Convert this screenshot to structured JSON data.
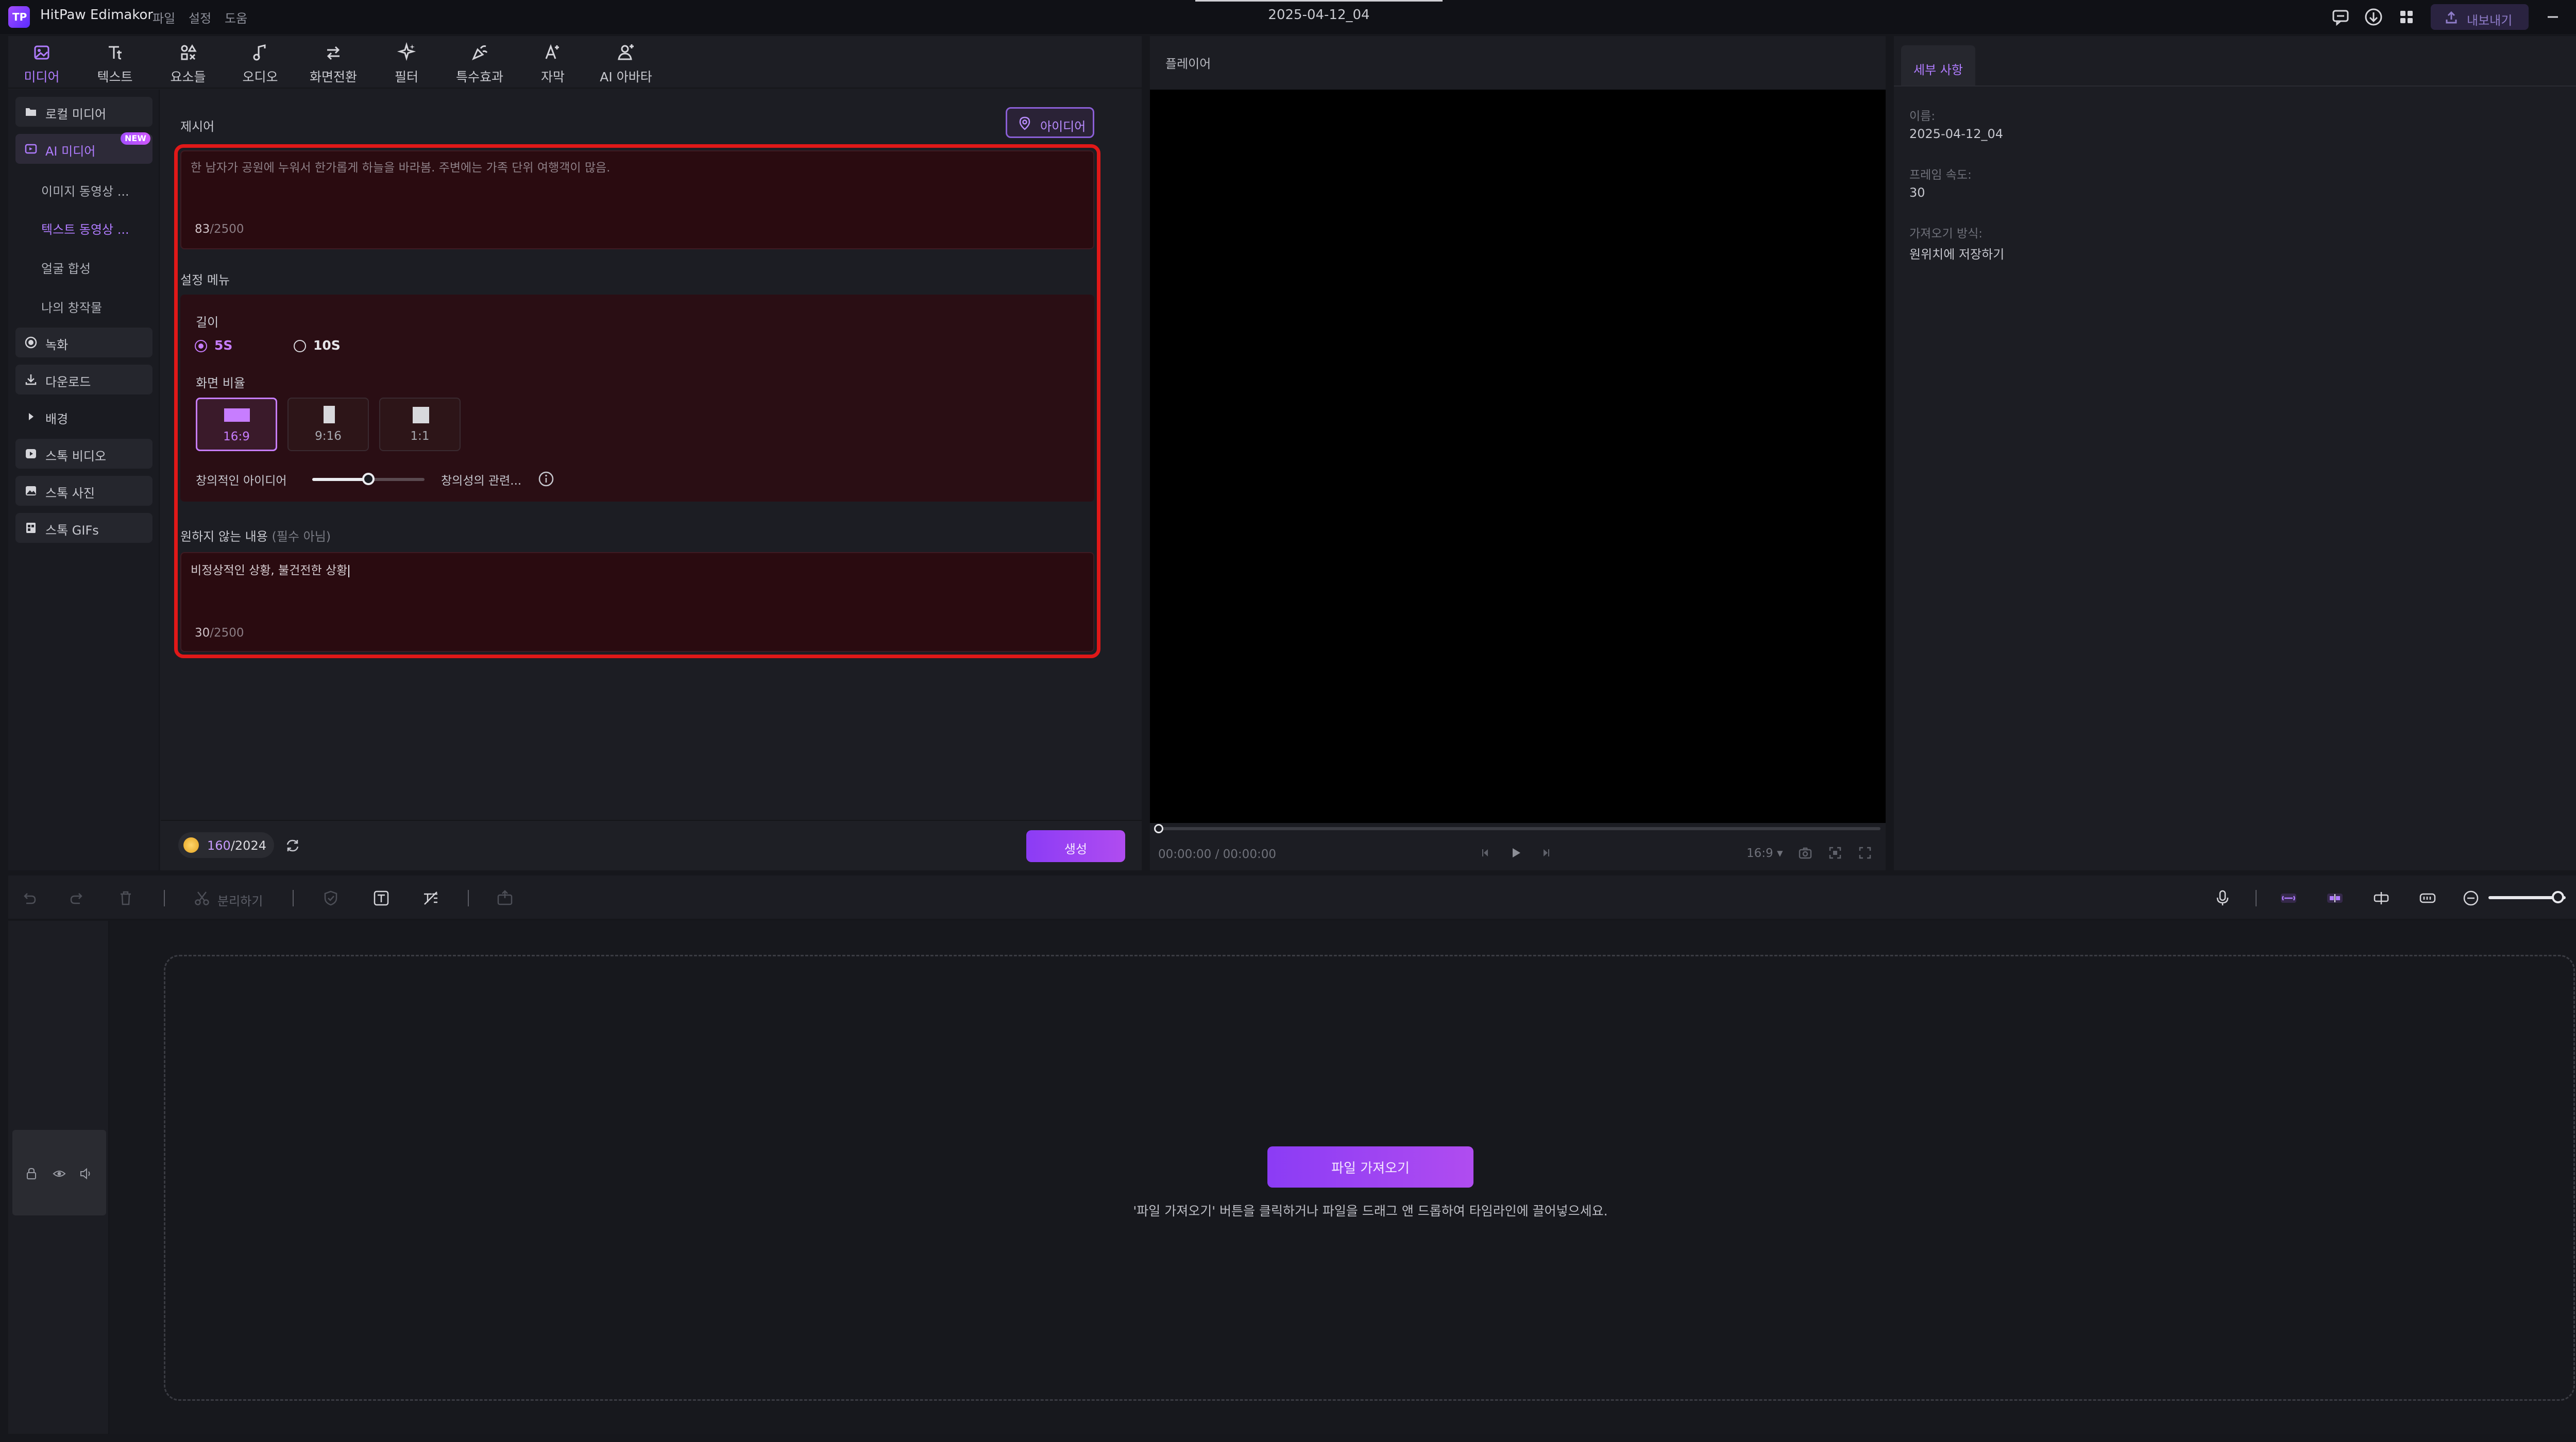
{
  "app": {
    "title": "HitPaw Edimakor",
    "menu": [
      "파일",
      "설정",
      "도움"
    ],
    "document_title": "2025-04-12_04",
    "export_label": "내보내기"
  },
  "toolbar": {
    "tabs": [
      {
        "label": "미디어",
        "icon": "media-icon",
        "active": true
      },
      {
        "label": "텍스트",
        "icon": "text-icon"
      },
      {
        "label": "요소들",
        "icon": "elements-icon"
      },
      {
        "label": "오디오",
        "icon": "audio-icon"
      },
      {
        "label": "화면전환",
        "icon": "transition-icon"
      },
      {
        "label": "필터",
        "icon": "filter-icon"
      },
      {
        "label": "특수효과",
        "icon": "effects-icon"
      },
      {
        "label": "자막",
        "icon": "subtitle-icon"
      },
      {
        "label": "AI 아바타",
        "icon": "avatar-icon"
      }
    ]
  },
  "sidebar": {
    "items": [
      {
        "label": "로컬 미디어",
        "icon": "folder-icon"
      },
      {
        "label": "AI 미디어",
        "icon": "ai-media-icon",
        "badge": "NEW",
        "active": true
      },
      {
        "label": "녹화",
        "icon": "record-icon"
      },
      {
        "label": "다운로드",
        "icon": "download-icon"
      },
      {
        "label": "배경",
        "icon": "triangle-right-icon"
      },
      {
        "label": "스톡 비디오",
        "icon": "video-icon"
      },
      {
        "label": "스톡 사진",
        "icon": "photo-icon"
      },
      {
        "label": "스톡 GIFs",
        "icon": "gif-icon"
      }
    ],
    "ai_sub": [
      {
        "label": "이미지 동영상 ..."
      },
      {
        "label": "텍스트 동영상 ...",
        "active": true
      },
      {
        "label": "얼굴 합성"
      },
      {
        "label": "나의 창작물"
      }
    ]
  },
  "prompt": {
    "label": "제시어",
    "idea_button": "아이디어",
    "text": "한 남자가 공원에 누워서 한가롭게 하늘을 바라봄. 주변에는 가족 단위 여행객이 많음.",
    "count": "83",
    "max": "/2500"
  },
  "settings": {
    "label": "설정 메뉴",
    "length_label": "길이",
    "length_options": [
      "5S",
      "10S"
    ],
    "length_selected": "5S",
    "ratio_label": "화면 비율",
    "ratios": [
      "16:9",
      "9:16",
      "1:1"
    ],
    "ratio_selected": "16:9",
    "creative_left": "창의적인 아이디어",
    "creative_right": "창의성의 관련...",
    "creativity_level": 0.5
  },
  "negative": {
    "label": "원하지 않는 내용",
    "optional": "(필수 아님)",
    "text": "비정상적인 상황, 불건전한 상황",
    "count": "30",
    "max": "/2500"
  },
  "credits": {
    "used": "160",
    "total": "/2024"
  },
  "generate_label": "생성",
  "player": {
    "header": "플레이어",
    "time": "00:00:00 / 00:00:00",
    "aspect": "16:9"
  },
  "details": {
    "tab": "세부 사항",
    "name_label": "이름:",
    "name_value": "2025-04-12_04",
    "fps_label": "프레임 속도:",
    "fps_value": "30",
    "import_label": "가져오기 방식:",
    "import_value": "원위치에 저장하기"
  },
  "timeline": {
    "split_label": "분리하기",
    "import_button": "파일 가져오기",
    "hint": "'파일 가져오기' 버튼을 클릭하거나 파일을 드래그 앤 드롭하여 타임라인에 끌어넣으세요.",
    "zoom_level": 0.9
  },
  "colors": {
    "accent": "#b04cf0",
    "highlight": "#e01818",
    "bg": "#16171c"
  }
}
